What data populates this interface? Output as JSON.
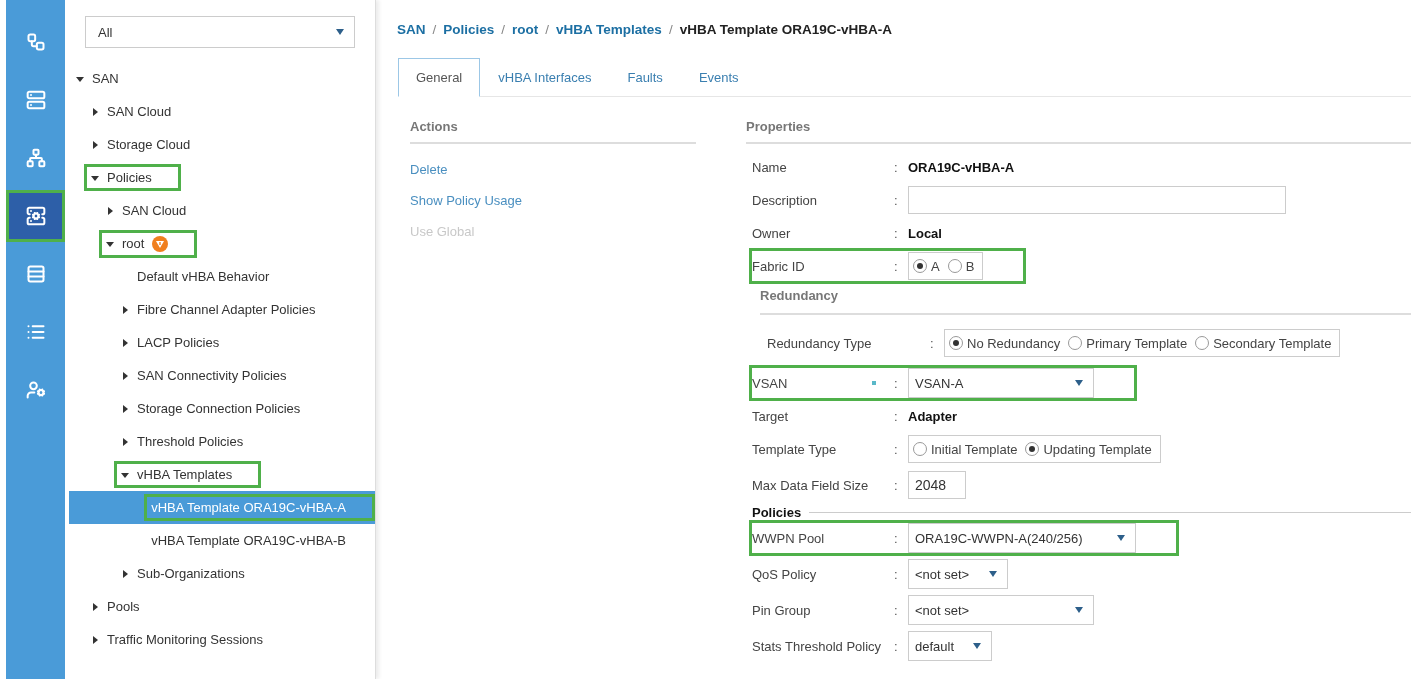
{
  "rail": [
    {
      "selected": false,
      "highlighted": false
    },
    {
      "selected": false,
      "highlighted": false
    },
    {
      "selected": false,
      "highlighted": false
    },
    {
      "selected": true,
      "highlighted": true
    },
    {
      "selected": false,
      "highlighted": false
    },
    {
      "selected": false,
      "highlighted": false
    },
    {
      "selected": false,
      "highlighted": false
    }
  ],
  "filter": {
    "value": "All"
  },
  "tree": [
    {
      "label": "SAN",
      "expanded": true,
      "selected": false,
      "highlighted": false,
      "children": [
        {
          "label": "SAN Cloud",
          "expanded": false,
          "selected": false,
          "highlighted": false
        },
        {
          "label": "Storage Cloud",
          "expanded": false,
          "selected": false,
          "highlighted": false
        },
        {
          "label": "Policies",
          "expanded": true,
          "selected": false,
          "highlighted": true,
          "children": [
            {
              "label": "SAN Cloud",
              "expanded": false,
              "selected": false,
              "highlighted": false
            },
            {
              "label": "root",
              "expanded": true,
              "selected": false,
              "highlighted": true,
              "warning": true,
              "children": [
                {
                  "label": "Default vHBA Behavior",
                  "selected": false,
                  "highlighted": false
                },
                {
                  "label": "Fibre Channel Adapter Policies",
                  "expanded": false,
                  "selected": false,
                  "highlighted": false
                },
                {
                  "label": "LACP Policies",
                  "expanded": false,
                  "selected": false,
                  "highlighted": false
                },
                {
                  "label": "SAN Connectivity Policies",
                  "expanded": false,
                  "selected": false,
                  "highlighted": false
                },
                {
                  "label": "Storage Connection Policies",
                  "expanded": false,
                  "selected": false,
                  "highlighted": false
                },
                {
                  "label": "Threshold Policies",
                  "expanded": false,
                  "selected": false,
                  "highlighted": false
                },
                {
                  "label": "vHBA Templates",
                  "expanded": true,
                  "selected": false,
                  "highlighted": true,
                  "children": [
                    {
                      "label": "vHBA Template ORA19C-vHBA-A",
                      "selected": true,
                      "highlighted": true
                    },
                    {
                      "label": "vHBA Template ORA19C-vHBA-B",
                      "selected": false,
                      "highlighted": false
                    }
                  ]
                },
                {
                  "label": "Sub-Organizations",
                  "expanded": false,
                  "selected": false,
                  "highlighted": false
                }
              ]
            }
          ]
        },
        {
          "label": "Pools",
          "expanded": false,
          "selected": false,
          "highlighted": false
        },
        {
          "label": "Traffic Monitoring Sessions",
          "expanded": false,
          "selected": false,
          "highlighted": false
        }
      ]
    }
  ],
  "breadcrumb": [
    "SAN",
    "/",
    "Policies",
    "/",
    "root",
    "/",
    "vHBA Templates",
    "/",
    "vHBA Template ORA19C-vHBA-A"
  ],
  "tabs": [
    {
      "label": "General",
      "selected": true
    },
    {
      "label": "vHBA Interfaces",
      "selected": false
    },
    {
      "label": "Faults",
      "selected": false
    },
    {
      "label": "Events",
      "selected": false
    }
  ],
  "actions": {
    "title": "Actions",
    "items": [
      {
        "label": "Delete",
        "disabled": false
      },
      {
        "label": "Show Policy Usage",
        "disabled": false
      },
      {
        "label": "Use Global",
        "disabled": true
      }
    ]
  },
  "properties": {
    "title": "Properties",
    "rows": [
      {
        "kind": "value",
        "label": "Name",
        "separator": ":",
        "value": "ORA19C-vHBA-A"
      },
      {
        "kind": "input",
        "label": "Description",
        "separator": ":"
      },
      {
        "kind": "value",
        "label": "Owner",
        "separator": ":",
        "value": "Local"
      },
      {
        "kind": "radio",
        "label": "Fabric ID",
        "separator": ":",
        "highlighted": true,
        "options": [
          {
            "label": "A",
            "selected": true
          },
          {
            "label": "B",
            "selected": false
          }
        ]
      },
      {
        "kind": "subsection",
        "title": "Redundancy"
      },
      {
        "kind": "radio",
        "label": "Redundancy Type",
        "separator": ":",
        "indented": true,
        "options": [
          {
            "label": "No Redundancy",
            "selected": true
          },
          {
            "label": "Primary Template",
            "selected": false
          },
          {
            "label": "Secondary Template",
            "selected": false
          }
        ]
      },
      {
        "kind": "select",
        "label": "VSAN",
        "separator": ":",
        "value": "VSAN-A",
        "highlighted": true,
        "required": true
      },
      {
        "kind": "value",
        "label": "Target",
        "separator": ":",
        "value": "Adapter"
      },
      {
        "kind": "radio",
        "label": "Template Type",
        "separator": ":",
        "options": [
          {
            "label": "Initial Template",
            "selected": false
          },
          {
            "label": "Updating Template",
            "selected": true
          }
        ]
      },
      {
        "kind": "input",
        "label": "Max Data Field Size",
        "separator": ":",
        "value": "2048"
      },
      {
        "kind": "section",
        "title": "Policies"
      },
      {
        "kind": "select",
        "label": "WWPN Pool",
        "separator": ":",
        "value": "ORA19C-WWPN-A(240/256)",
        "highlighted": true
      },
      {
        "kind": "select",
        "label": "QoS Policy",
        "separator": ":",
        "value": "<not set>"
      },
      {
        "kind": "select",
        "label": "Pin Group",
        "separator": ":",
        "value": "<not set>"
      },
      {
        "kind": "select",
        "label": "Stats Threshold Policy",
        "separator": ":",
        "value": "default"
      }
    ]
  }
}
